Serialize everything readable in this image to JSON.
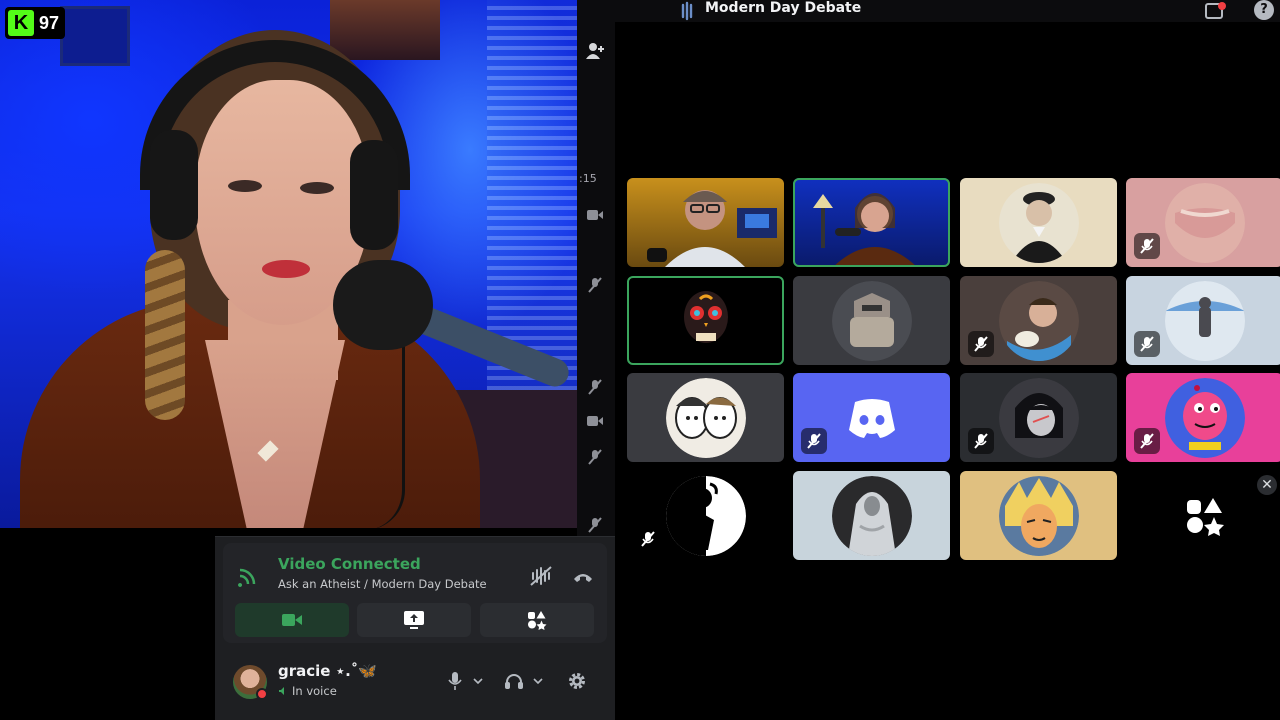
{
  "stream": {
    "badge_count": "97",
    "badge_letter": "K"
  },
  "top_bar": {
    "channel_title": "Modern Day Debate",
    "help_label": "?"
  },
  "side_strip": {
    "timer_fragment": ":15"
  },
  "grid": {
    "tiles": [
      {
        "type": "video",
        "speaking": false,
        "muted": false,
        "desc": "webcam-man"
      },
      {
        "type": "video",
        "speaking": true,
        "muted": false,
        "desc": "webcam-woman"
      },
      {
        "type": "avatar",
        "speaking": false,
        "muted": false,
        "desc": "portrait-gauss",
        "bg": "#e8dcc0"
      },
      {
        "type": "avatar",
        "speaking": false,
        "muted": true,
        "desc": "pink-blur",
        "bg": "#d8a0a0"
      },
      {
        "type": "avatar",
        "speaking": true,
        "muted": false,
        "desc": "sugar-skull",
        "bg": "#000000"
      },
      {
        "type": "avatar",
        "speaking": false,
        "muted": false,
        "desc": "robot",
        "bg": "#3a3b40"
      },
      {
        "type": "avatar",
        "speaking": false,
        "muted": true,
        "desc": "depp-crown",
        "bg": "#4a3f3c"
      },
      {
        "type": "avatar",
        "speaking": false,
        "muted": true,
        "desc": "snow-figure",
        "bg": "#c8d4e0"
      },
      {
        "type": "avatar",
        "speaking": false,
        "muted": false,
        "desc": "cartoon-duo",
        "bg": "#3a3b40"
      },
      {
        "type": "avatar",
        "speaking": false,
        "muted": true,
        "desc": "discord-logo",
        "bg": "#5865f2"
      },
      {
        "type": "avatar",
        "speaking": false,
        "muted": true,
        "desc": "anime-girl",
        "bg": "#2b2d31"
      },
      {
        "type": "avatar",
        "speaking": false,
        "muted": true,
        "desc": "pink-creature",
        "bg": "#e8409a"
      },
      {
        "type": "avatar",
        "speaking": false,
        "muted": true,
        "desc": "bw-silhouette",
        "bg": "#000000"
      },
      {
        "type": "avatar",
        "speaking": false,
        "muted": false,
        "desc": "statue",
        "bg": "#c8d4dc"
      },
      {
        "type": "avatar",
        "speaking": false,
        "muted": false,
        "desc": "anime-warrior",
        "bg": "#e0c080"
      },
      {
        "type": "activity",
        "speaking": false,
        "muted": false,
        "desc": "activities",
        "bg": "#000000"
      }
    ],
    "close_label": "✕"
  },
  "voice": {
    "status_title": "Video Connected",
    "status_subtitle": "Ask an Atheist / Modern Day Debate",
    "status_color": "#3ba55d"
  },
  "user": {
    "name": "gracie ⋆.˚🦋",
    "status": "In voice"
  },
  "colors": {
    "accent_green": "#3ba55d",
    "blurple": "#5865f2",
    "kick_green": "#53fc18",
    "dnd_red": "#f23f43"
  }
}
